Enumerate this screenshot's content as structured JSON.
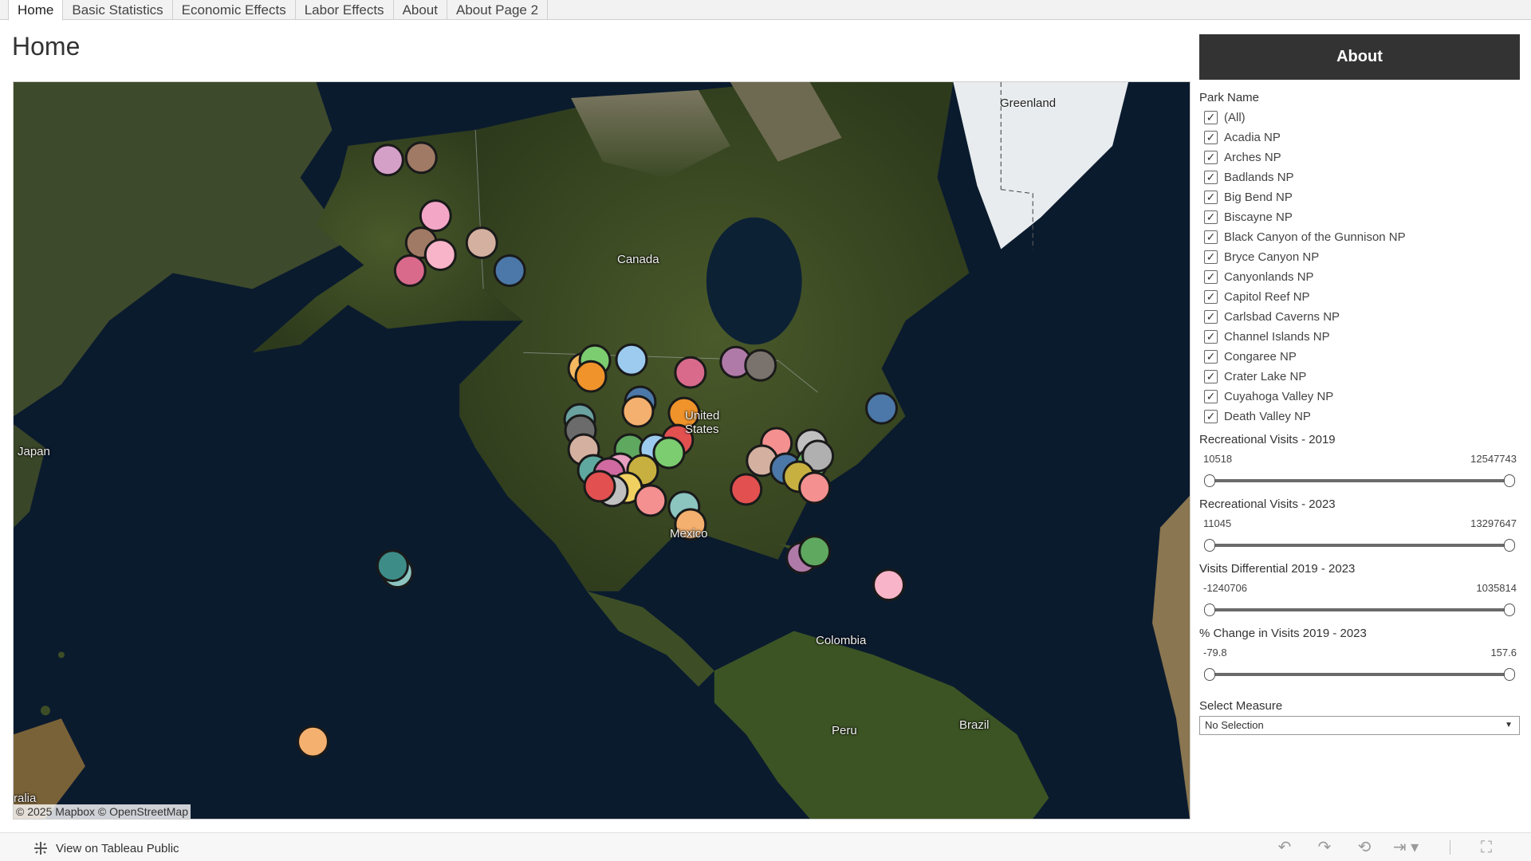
{
  "tabs": [
    {
      "label": "Home",
      "active": true
    },
    {
      "label": "Basic Statistics",
      "active": false
    },
    {
      "label": "Economic Effects",
      "active": false
    },
    {
      "label": "Labor Effects",
      "active": false
    },
    {
      "label": "About",
      "active": false
    },
    {
      "label": "About Page 2",
      "active": false
    }
  ],
  "page_title": "Home",
  "map": {
    "labels": {
      "greenland": "Greenland",
      "canada": "Canada",
      "united_states": "United States",
      "japan": "Japan",
      "mexico": "Mexico",
      "colombia": "Colombia",
      "peru": "Peru",
      "brazil": "Brazil",
      "australia_fragment": "ralia"
    },
    "attribution": "© 2025 Mapbox © OpenStreetMap"
  },
  "panel": {
    "about_button": "About",
    "park_filter": {
      "title": "Park Name",
      "items": [
        {
          "label": "(All)",
          "checked": true
        },
        {
          "label": "Acadia NP",
          "checked": true
        },
        {
          "label": "Arches NP",
          "checked": true
        },
        {
          "label": "Badlands NP",
          "checked": true
        },
        {
          "label": "Big Bend NP",
          "checked": true
        },
        {
          "label": "Biscayne NP",
          "checked": true
        },
        {
          "label": "Black Canyon of the Gunnison NP",
          "checked": true
        },
        {
          "label": "Bryce Canyon NP",
          "checked": true
        },
        {
          "label": "Canyonlands NP",
          "checked": true
        },
        {
          "label": "Capitol Reef NP",
          "checked": true
        },
        {
          "label": "Carlsbad Caverns NP",
          "checked": true
        },
        {
          "label": "Channel Islands NP",
          "checked": true
        },
        {
          "label": "Congaree NP",
          "checked": true
        },
        {
          "label": "Crater Lake NP",
          "checked": true
        },
        {
          "label": "Cuyahoga Valley NP",
          "checked": true
        },
        {
          "label": "Death Valley NP",
          "checked": true
        }
      ]
    },
    "sliders": [
      {
        "title": "Recreational Visits - 2019",
        "min": "10518",
        "max": "12547743"
      },
      {
        "title": "Recreational  Visits - 2023",
        "min": "11045",
        "max": "13297647"
      },
      {
        "title": "Visits Differential 2019 - 2023",
        "min": "-1240706",
        "max": "1035814"
      },
      {
        "title": "% Change in Visits 2019 - 2023",
        "min": "-79.8",
        "max": "157.6"
      }
    ],
    "select_measure": {
      "title": "Select Measure",
      "value": "No Selection"
    }
  },
  "toolbar": {
    "view_link": "View on Tableau Public",
    "icons": [
      "undo-icon",
      "redo-icon",
      "revert-icon",
      "share-icon",
      "fullscreen-icon"
    ]
  }
}
